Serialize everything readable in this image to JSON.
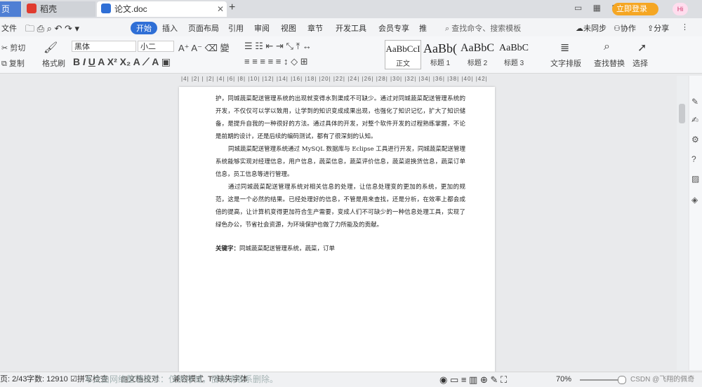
{
  "titlebar": {
    "tab1": "页",
    "tab2": "稻壳",
    "tab3": "论文.doc",
    "login": "立即登录",
    "badge": "Hi"
  },
  "ribbon_tabs": [
    "文件",
    "开始",
    "插入",
    "页面布局",
    "引用",
    "审阅",
    "视图",
    "章节",
    "开发工具",
    "会员专享",
    "推"
  ],
  "ribbon_search": "查找命令、搜索模板",
  "ribbon_right": {
    "sync": "未同步",
    "collab": "协作",
    "share": "分享"
  },
  "toolbar": {
    "cut": "剪切",
    "copy": "复制",
    "format_painter": "格式刷",
    "font_name": "黑体",
    "font_size": "小二",
    "styles": [
      {
        "preview": "AaBbCcI",
        "label": "正文"
      },
      {
        "preview": "AaBb(",
        "label": "标题 1"
      },
      {
        "preview": "AaBbC",
        "label": "标题 2"
      },
      {
        "preview": "AaBbC",
        "label": "标题 3"
      }
    ],
    "text_layout": "文字排版",
    "find_replace": "查找替换",
    "select": "选择"
  },
  "ruler": "|4| |2| | |2| |4| |6| |8| |10| |12| |14| |16| |18| |20| |22| |24| |26| |28| |30| |32| |34| |36| |38| |40| |42|",
  "document": {
    "para1": "护，同城蔬菜配送管理系统的出现就变得水到渠成不可缺少。通过对同城蔬菜配送管理系统的开发，不仅仅可以学以致用，让学到的知识变成成果出现，也强化了知识记忆，扩大了知识储备，是提升自我的一种很好的方法。通过具体的开发，对整个软件开发的过程熟练掌握，不论是前期的设计，还是后续的编码测试，都有了很深刻的认知。",
    "para2": "同城蔬菜配送管理系统通过 MySQL 数据库与 Eclipse 工具进行开发，同城蔬菜配送管理系统能够实现对经理信息，用户信息，蔬菜信息，蔬菜评价信息，蔬菜退换货信息，蔬菜订单信息，员工信息等进行管理。",
    "para3": "通过同城蔬菜配送管理系统对相关信息的处理，让信息处理变的更加的系统，更加的规范，这是一个必然的结果。已经处理好的信息，不管是用来查找，还是分析，在效率上都会成倍的提高，让计算机变得更加符合生产需要，变成人们不可缺少的一种信息处理工具，实现了绿色办公，节省社会资源，为环境保护也做了力所能及的贡献。",
    "keywords_label": "关键字：",
    "keywords": "同城蔬菜配送管理系统，蔬菜，订单"
  },
  "statusbar": {
    "page": "页: 2/43",
    "words": "字数: 12910",
    "spell": "拼写检查",
    "proof": "文档校对",
    "compat": "兼容模式",
    "font_missing": "缺失字体",
    "zoom": "70%",
    "watermark": "CSDN @飞翔的佩奇",
    "overlay": "本文由网络整理提示：仅供存储，侵权请联系删除。"
  },
  "colors": {
    "accent": "#2f6fd6",
    "page_bg": "#ffffff",
    "app_bg": "#e9eaec",
    "login": "#f5a623"
  }
}
